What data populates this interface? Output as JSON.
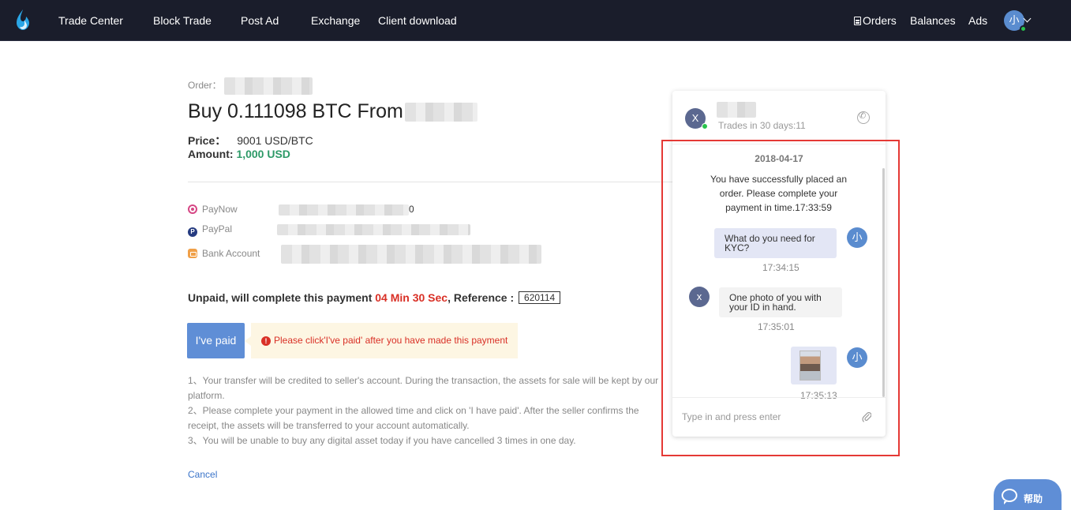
{
  "nav": {
    "items": [
      "Trade Center",
      "Block Trade",
      "Post Ad",
      "Exchange",
      "Client download"
    ],
    "orders": "Orders",
    "balances": "Balances",
    "ads": "Ads",
    "avatar_char": "小"
  },
  "order": {
    "label": "Order：",
    "heading": "Buy 0.111098 BTC From",
    "price_label": "Price：",
    "price_value": "9001 USD/BTC",
    "amount_label": "Amount:",
    "amount_value": "1,000 USD"
  },
  "payment_methods": [
    {
      "name": "PayNow",
      "value_suffix": "0"
    },
    {
      "name": "PayPal",
      "value_suffix": ""
    },
    {
      "name": "Bank Account",
      "value_suffix": ""
    }
  ],
  "status": {
    "prefix": "Unpaid, will complete this payment",
    "timer": "04 Min 30 Sec",
    "ref_label": ", Reference :",
    "reference": "620114"
  },
  "actions": {
    "paid_button": "I've paid",
    "notice": "Please click'I've paid' after you have made this payment",
    "cancel": "Cancel"
  },
  "instructions": [
    "1、Your transfer will be credited to seller's account. During the transaction, the assets for sale will be kept by our platform.",
    "2、Please complete your payment in the allowed time and click on 'I have paid'. After the seller confirms the receipt, the assets will be transferred to your account automatically.",
    "3、You will be unable to buy any digital asset today if you have cancelled 3 times in one day."
  ],
  "chat": {
    "counterparty_initial": "X",
    "trades": "Trades in 30 days:11",
    "date": "2018-04-17",
    "system_message": "You have successfully placed an order. Please complete your payment in time.17:33:59",
    "messages": [
      {
        "from": "me",
        "avatar": "小",
        "text": "What do you need for KYC?",
        "time": "17:34:15"
      },
      {
        "from": "them",
        "avatar": "x",
        "text": "One photo of you with your ID in hand.",
        "time": "17:35:01"
      },
      {
        "from": "me",
        "avatar": "小",
        "text": "",
        "time": "17:35:13"
      }
    ],
    "input_placeholder": "Type in and press enter"
  },
  "help": {
    "label": "帮助"
  },
  "colors": {
    "nav_bg": "#1a1d2b",
    "accent": "#5f8ed6",
    "amount_green": "#2e9a68",
    "timer_red": "#d93026",
    "annotation_red": "#e53935"
  }
}
